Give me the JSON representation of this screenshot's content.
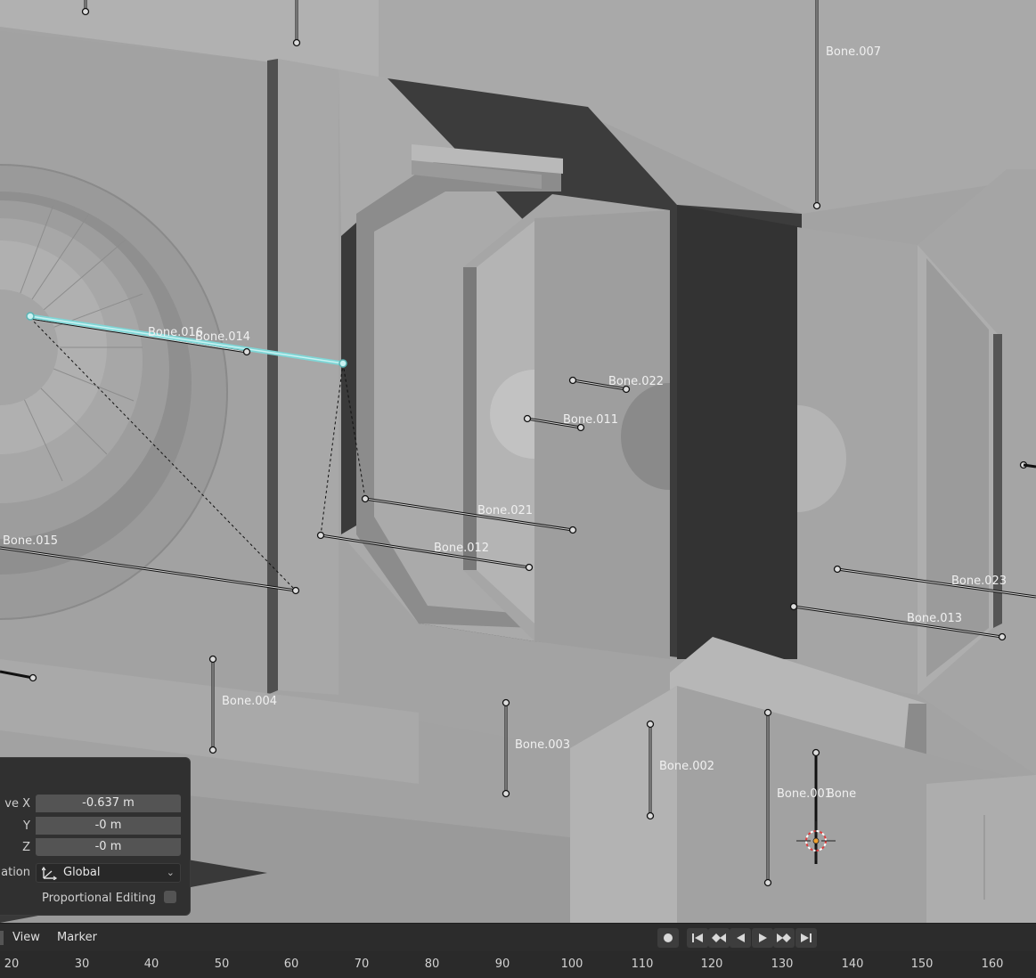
{
  "viewport": {
    "bones": [
      "Bone.007",
      "Bone.016",
      "Bone.014",
      "Bone.022",
      "Bone.011",
      "Bone.021",
      "Bone.012",
      "Bone.015",
      "Bone.023",
      "Bone.013",
      "Bone.004",
      "Bone.003",
      "Bone.002",
      "Bone.001",
      "Bone"
    ],
    "active_bone": "Bone.014",
    "colors": {
      "active_bone": "#7fd6d6",
      "cursor": "#e03c3c",
      "background_model": "#9c9c9c"
    }
  },
  "operator_panel": {
    "move_x_label": "ve X",
    "move_x_value": "-0.637 m",
    "y_label": "Y",
    "y_value": "-0 m",
    "z_label": "Z",
    "z_value": "-0 m",
    "orientation_label": "ation",
    "orientation_value": "Global",
    "orientation_icon": "transform-orientation-icon",
    "proportional_editing_label": "Proportional Editing",
    "proportional_editing_checked": false
  },
  "timeline": {
    "menus": {
      "view": "View",
      "marker": "Marker"
    },
    "transport_icons": [
      "record-icon",
      "jump-start-icon",
      "prev-keyframe-icon",
      "play-reverse-icon",
      "play-icon",
      "next-keyframe-icon",
      "jump-end-icon"
    ],
    "frames": [
      "20",
      "30",
      "40",
      "50",
      "60",
      "70",
      "80",
      "90",
      "100",
      "110",
      "120",
      "130",
      "140",
      "150",
      "160"
    ]
  }
}
